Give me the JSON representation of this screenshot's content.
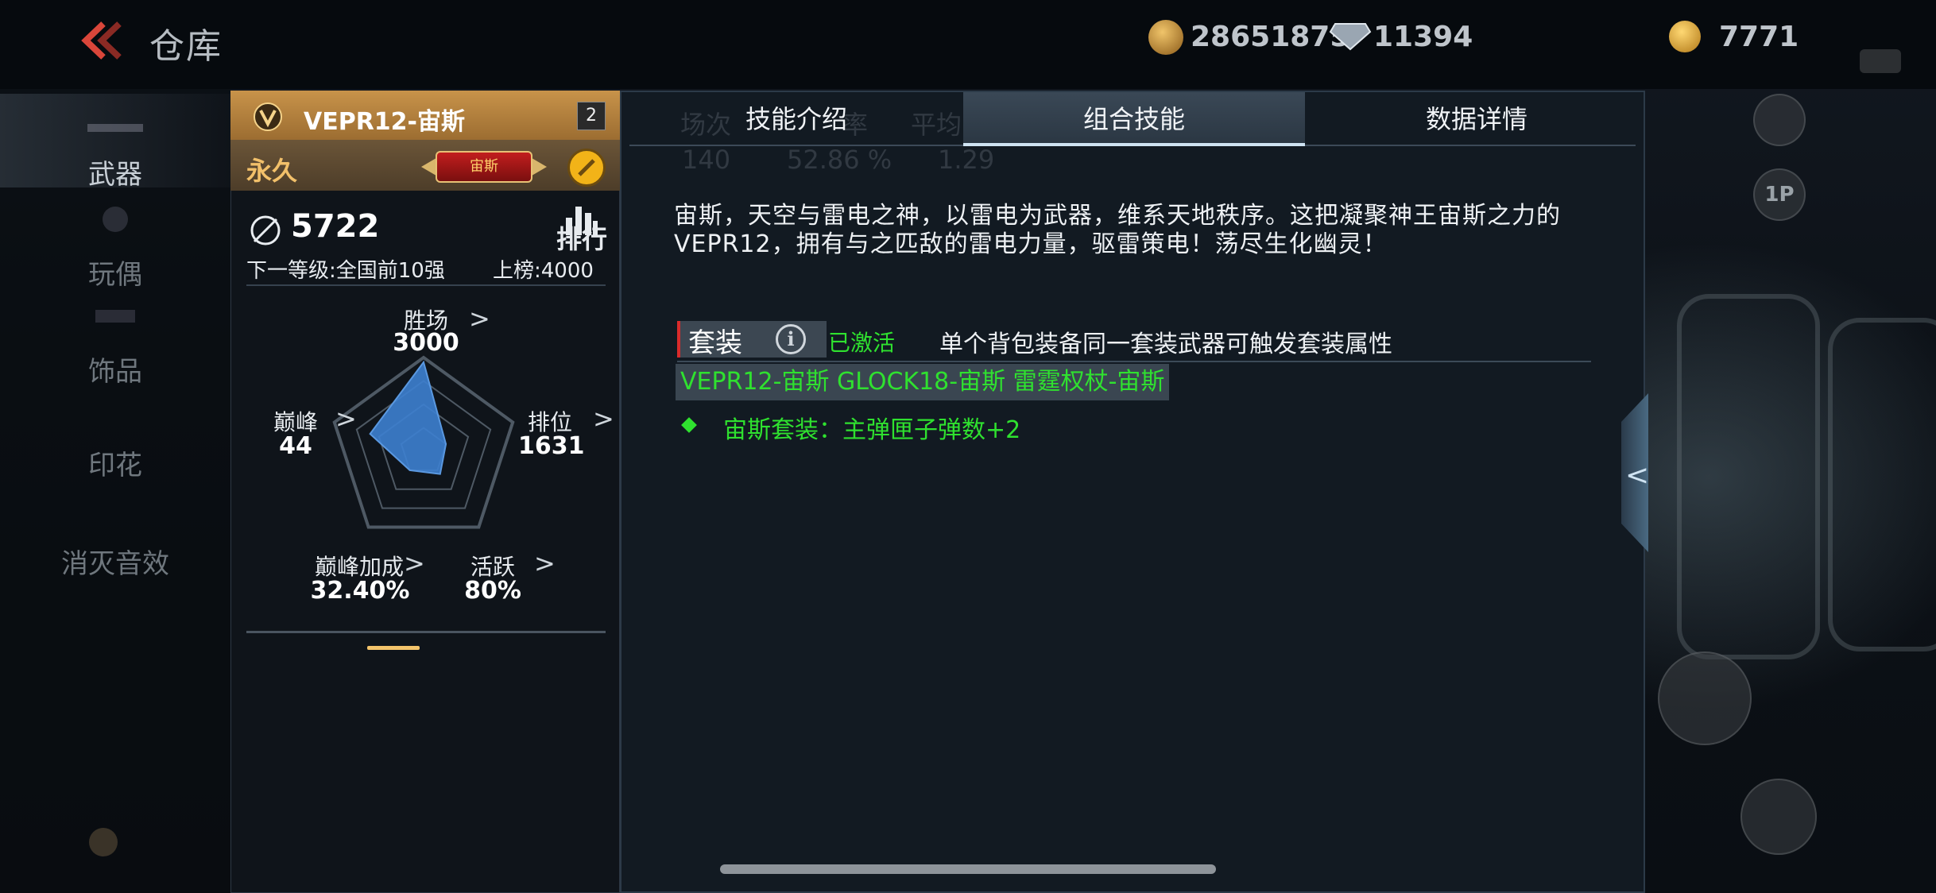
{
  "header": {
    "title": "仓库",
    "coins": "28651875",
    "diamonds": "11394",
    "gold": "7771"
  },
  "nav": {
    "items": [
      {
        "label": "武器",
        "active": true
      },
      {
        "label": "玩偶",
        "active": false
      },
      {
        "label": "饰品",
        "active": false
      },
      {
        "label": "印花",
        "active": false
      },
      {
        "label": "消灭音效",
        "active": false
      }
    ]
  },
  "weapon": {
    "name": "VEPR12-宙斯",
    "count": "2",
    "duration": "永久",
    "series_badge": "宙斯",
    "rank_score": "5722",
    "rank_link": "排行",
    "next_level": "下一等级:全国前10强",
    "board_threshold": "上榜:4000",
    "stats": {
      "wins": {
        "label": "胜场",
        "value": "3000"
      },
      "ranked": {
        "label": "排位",
        "value": "1631"
      },
      "peak": {
        "label": "巅峰",
        "value": "44"
      },
      "peak_bonus": {
        "label": "巅峰加成",
        "value": "32.40%"
      },
      "activity": {
        "label": "活跃",
        "value": "80%"
      }
    },
    "radar_levels": [
      0.95,
      0.25,
      0.3,
      0.25,
      0.6
    ]
  },
  "tabs": [
    {
      "label": "技能介绍",
      "active": false
    },
    {
      "label": "组合技能",
      "active": true
    },
    {
      "label": "数据详情",
      "active": false
    }
  ],
  "ghost_stats": {
    "headers": [
      "场次",
      "率",
      "平均KDA"
    ],
    "values": [
      "140",
      "52.86 %",
      "1.29"
    ]
  },
  "skill": {
    "description": "宙斯，天空与雷电之神，以雷电为武器，维系天地秩序。这把凝聚神王宙斯之力的VEPR12，拥有与之匹敌的雷电力量，驱雷策电！荡尽生化幽灵！",
    "set_label": "套装",
    "set_status": "已激活",
    "set_desc": "单个背包装备同一套装武器可触发套装属性",
    "set_weapons": "VEPR12-宙斯 GLOCK18-宙斯 雷霆权杖-宙斯",
    "set_bonus": "宙斯套装：主弹匣子弹数+2"
  },
  "side": {
    "badge": "1P"
  },
  "colors": {
    "accent_gold": "#c8934a",
    "active_green": "#2fe12f",
    "radar_fill": "#3d7fd0"
  }
}
